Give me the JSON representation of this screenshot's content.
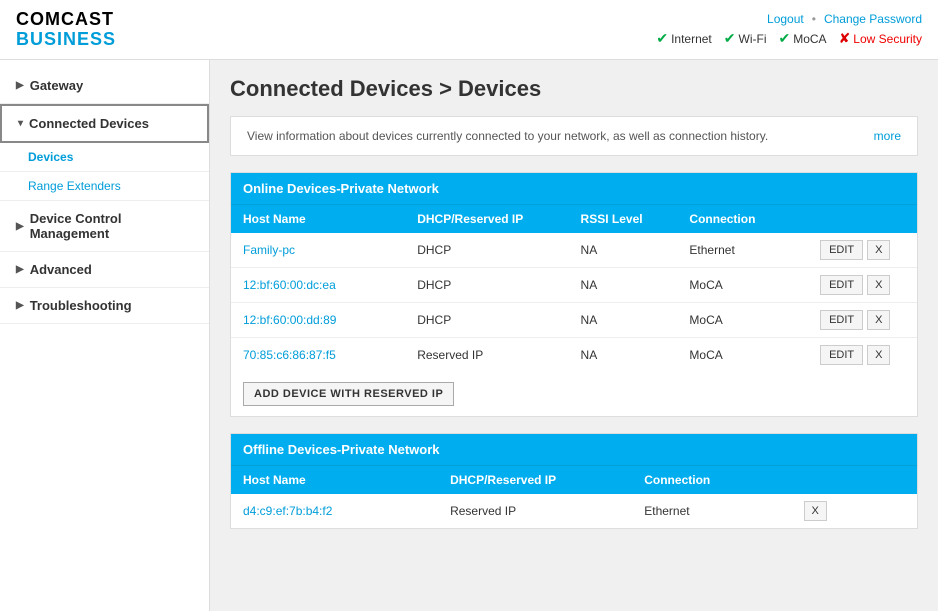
{
  "header": {
    "logo_line1": "COMCAST",
    "logo_line2": "BUSINESS",
    "links": {
      "logout": "Logout",
      "separator": "•",
      "change_password": "Change Password"
    },
    "status_items": [
      {
        "label": "Internet",
        "state": "ok"
      },
      {
        "label": "Wi-Fi",
        "state": "ok"
      },
      {
        "label": "MoCA",
        "state": "ok"
      },
      {
        "label": "Low Security",
        "state": "warn"
      }
    ]
  },
  "sidebar": {
    "items": [
      {
        "id": "gateway",
        "label": "Gateway",
        "arrow": "▶",
        "active": false
      },
      {
        "id": "connected-devices",
        "label": "Connected Devices",
        "arrow": "▾",
        "active": true
      },
      {
        "id": "devices-sub",
        "label": "Devices",
        "sub": true,
        "active": true
      },
      {
        "id": "range-extenders-sub",
        "label": "Range Extenders",
        "sub": true,
        "active": false
      },
      {
        "id": "device-control",
        "label": "Device Control Management",
        "arrow": "▶",
        "active": false
      },
      {
        "id": "advanced",
        "label": "Advanced",
        "arrow": "▶",
        "active": false
      },
      {
        "id": "troubleshooting",
        "label": "Troubleshooting",
        "arrow": "▶",
        "active": false
      }
    ]
  },
  "page_title": "Connected Devices > Devices",
  "info_text": "View information about devices currently connected to your network, as well as connection history.",
  "more_link": "more",
  "online_section": {
    "header": "Online Devices-Private Network",
    "columns": [
      "Host Name",
      "DHCP/Reserved IP",
      "RSSI Level",
      "Connection"
    ],
    "rows": [
      {
        "hostname": "Family-pc",
        "dhcp": "DHCP",
        "rssi": "NA",
        "connection": "Ethernet"
      },
      {
        "hostname": "12:bf:60:00:dc:ea",
        "dhcp": "DHCP",
        "rssi": "NA",
        "connection": "MoCA"
      },
      {
        "hostname": "12:bf:60:00:dd:89",
        "dhcp": "DHCP",
        "rssi": "NA",
        "connection": "MoCA"
      },
      {
        "hostname": "70:85:c6:86:87:f5",
        "dhcp": "Reserved IP",
        "rssi": "NA",
        "connection": "MoCA"
      }
    ],
    "add_button": "ADD DEVICE WITH RESERVED IP",
    "edit_label": "EDIT",
    "x_label": "X"
  },
  "offline_section": {
    "header": "Offline Devices-Private Network",
    "columns": [
      "Host Name",
      "DHCP/Reserved IP",
      "Connection"
    ],
    "rows": [
      {
        "hostname": "d4:c9:ef:7b:b4:f2",
        "dhcp": "Reserved IP",
        "connection": "Ethernet"
      }
    ],
    "x_label": "X"
  }
}
